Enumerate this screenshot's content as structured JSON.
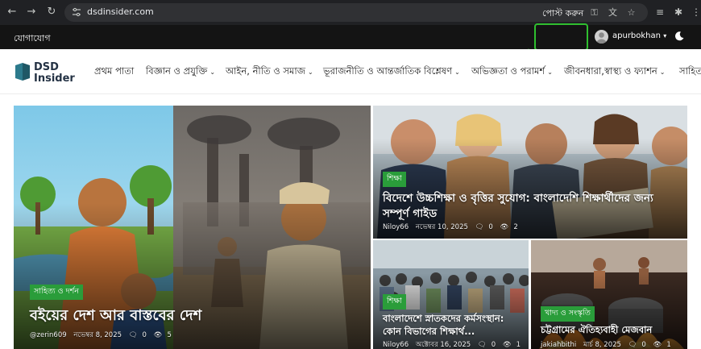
{
  "browser": {
    "url": "dsdinsider.com",
    "icons": [
      "back-icon",
      "forward-icon",
      "reload-icon",
      "site-info-icon",
      "password-key-icon",
      "translate-icon",
      "bookmark-star-icon",
      "reading-list-icon",
      "extension-icon",
      "menu-icon"
    ]
  },
  "topbar": {
    "contact": "যোগাযোগ",
    "post": "পোস্ট করুন",
    "username": "apurbokhan",
    "caret": "▾"
  },
  "logo": {
    "line1": "DSD",
    "line2": "Insider"
  },
  "nav": {
    "items": [
      {
        "label": "প্রথম পাতা",
        "dropdown": false
      },
      {
        "label": "বিজ্ঞান ও প্রযুক্তি",
        "dropdown": true
      },
      {
        "label": "আইন, নীতি ও সমাজ",
        "dropdown": true
      },
      {
        "label": "ভূরাজনীতি ও আন্তর্জাতিক বিশ্লেষণ",
        "dropdown": true
      },
      {
        "label": "অভিজ্ঞতা ও পরামর্শ",
        "dropdown": true
      },
      {
        "label": "জীবনধারা,স্বাস্থ্য ও ফ্যাশন",
        "dropdown": true
      },
      {
        "label": "সাহিত্য",
        "dropdown": false
      }
    ]
  },
  "posts": [
    {
      "category": "সাহিত্য ও দর্শন",
      "title": "বইয়ের দেশ আর বাস্তবের দেশ",
      "author": "@zerin609",
      "date": "নভেম্বর 8, 2025",
      "comments": "0",
      "views": "5"
    },
    {
      "category": "শিক্ষা",
      "title_line1": "বিদেশে উচ্চশিক্ষা ও বৃত্তির সুযোগ: বাংলাদেশি শিক্ষার্থীদের জন্য",
      "title_line2": "সম্পূর্ণ গাইড",
      "author": "Niloy66",
      "date": "নভেম্বর 10, 2025",
      "comments": "0",
      "views": "2"
    },
    {
      "category": "শিক্ষা",
      "title_line1": "বাংলাদেশে স্নাতকদের কর্মসংস্থান:",
      "title_line2": "কোন বিভাগের শিক্ষার্থ...",
      "author": "Niloy66",
      "date": "অক্টোবর 16, 2025",
      "comments": "0",
      "views": "1"
    },
    {
      "category": "খাদ্য ও সংস্কৃতি",
      "title": "চট্টগ্রামের ঐতিহ্যবাহী মেজবান",
      "author": "jakiahbithi",
      "date": "মার্চ 8, 2025",
      "comments": "0",
      "views": "1"
    }
  ],
  "colors": {
    "accent_green": "#2a9d3a",
    "annotation_green": "#2fbf2f",
    "topbar_bg": "#141414",
    "chrome_bg": "#202124"
  }
}
